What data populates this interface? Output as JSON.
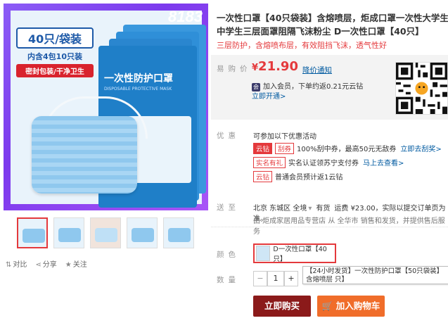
{
  "product": {
    "title": "一次性口罩【40只袋装】含熔喷层，炬成口罩一次性大学生中学生三层面罩阻隔飞沫粉尘 D一次性口罩【40只】",
    "promo_text": "三层防护，含熔喷布层，有效阻挡飞沫，透气性好"
  },
  "image": {
    "badge": "8183",
    "pack_count": "40只/袋装",
    "pack_detail": "内含4包10只装",
    "pack_tag": "密封包装/干净卫生",
    "bag_title": "一次性防护口罩",
    "bag_sub": "DISPOSABLE PROTECTIVE MASK"
  },
  "actions": {
    "compare": "对比",
    "share": "分享",
    "follow": "关注"
  },
  "price": {
    "label": "易购价",
    "currency": "¥",
    "value": "21.90",
    "notify": "降价通知",
    "vip_icon": "会",
    "vip_text": "加入会员，下单约返0.21元云钻",
    "vip_open": "立即开通>"
  },
  "offers": {
    "label": "优惠",
    "intro": "可参加以下优惠活动",
    "rows": [
      {
        "tag1": "云钻",
        "tag2": "刮券",
        "text": "100%刮中券，最高50元无敌券",
        "link": "立即去刮奖>"
      },
      {
        "tag1": "实名有礼",
        "text": "实名认证领苏宁支付券",
        "link": "马上去查看>"
      },
      {
        "tag1": "云钻",
        "text": "普通会员预计返1云钻"
      }
    ]
  },
  "delivery": {
    "label": "送至",
    "location": "北京 东城区 全境",
    "stock": "有货",
    "fee": "运费 ¥23.00，实际以提交订单页为准。",
    "shipper": "由 炬成家居用品专营店 从 全华市 销售和发货，并提供售后服务"
  },
  "color": {
    "label": "颜色",
    "selected": "D一次性口罩【40只】"
  },
  "quantity": {
    "label": "数量",
    "minus": "−",
    "value": "1",
    "plus": "+"
  },
  "tooltip": "【24小时发货】一次性防护口罩【50只袋装】含熔喷层 只】",
  "buttons": {
    "buy_now": "立即购买",
    "add_cart": "加入购物车",
    "cart_icon": "🛒"
  },
  "colors": {
    "accent_red": "#e4393c",
    "buy_button": "#8b1a1a",
    "cart_button": "#f06d2a",
    "link_blue": "#005aa0"
  }
}
